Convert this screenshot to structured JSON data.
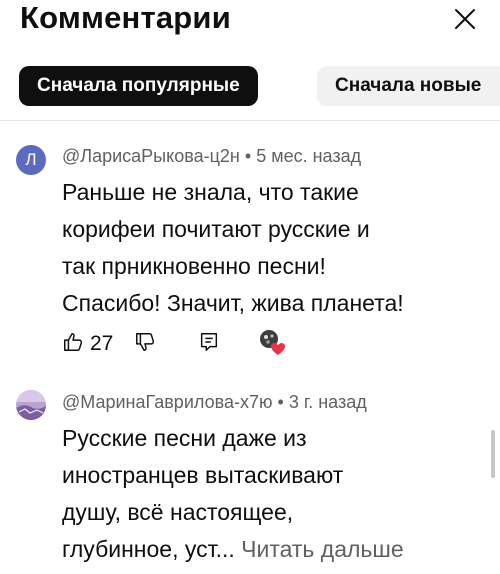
{
  "header": {
    "title": "Комментарии"
  },
  "sort_chips": [
    {
      "label": "Сначала популярные",
      "active": true
    },
    {
      "label": "Сначала новые",
      "active": false
    }
  ],
  "comments": [
    {
      "avatar_letter": "Л",
      "author": "@ЛарисаРыкова-ц2н",
      "time": "5 мес. назад",
      "lines": [
        "Раньше не знала, что такие",
        "корифеи почитают русские и",
        "так прникновенно песни!",
        "Спасибо! Значит, жива планета!"
      ],
      "likes": "27"
    },
    {
      "author": "@МаринаГаврилова-х7ю",
      "time": "3 г. назад",
      "lines": [
        "Русские песни даже из",
        "иностранцев вытаскивают",
        "душу, всё настоящее,"
      ],
      "last_line": "глубинное, уст...",
      "read_more": "Читать дальше"
    }
  ],
  "separator": "•",
  "colors": {
    "heart": "#e8334a",
    "avatar_bg": "#5c6bc0"
  },
  "icons": [
    "close-icon",
    "like-icon",
    "dislike-icon",
    "reply-icon",
    "creator-heart-icon"
  ]
}
